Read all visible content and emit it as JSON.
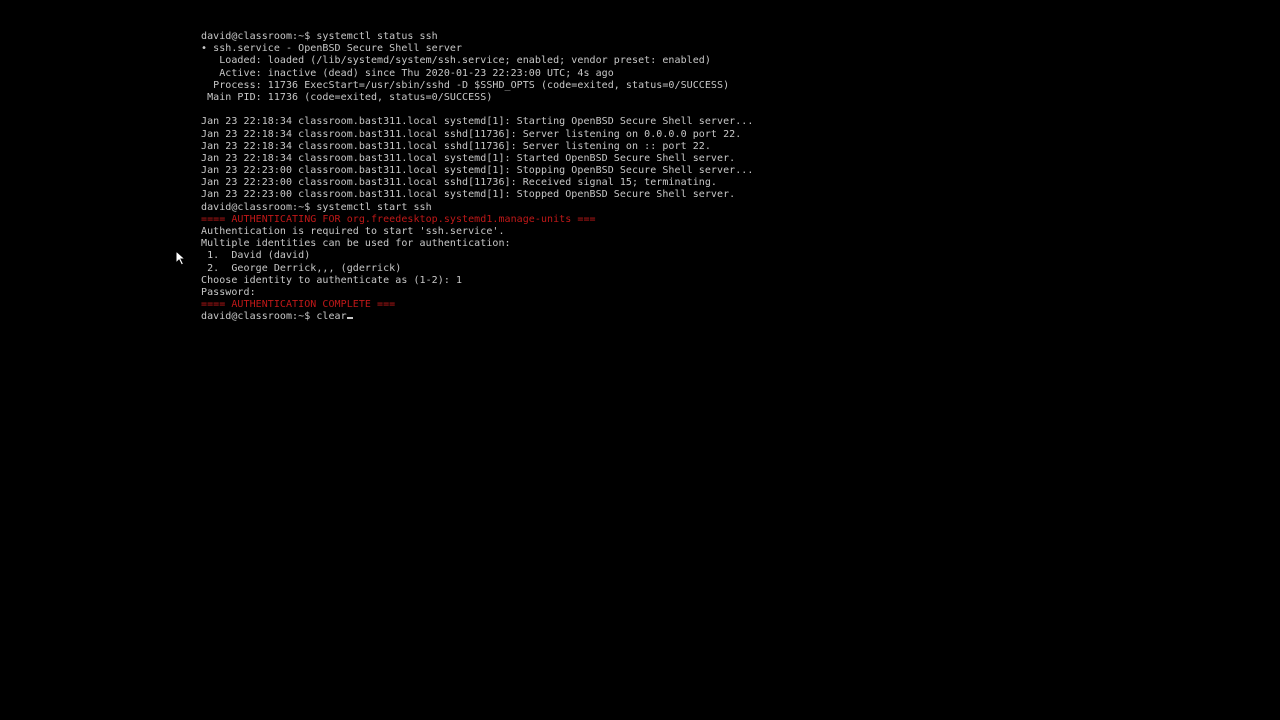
{
  "terminal": {
    "status_block": {
      "prompt": "david@classroom:~$ systemctl status ssh",
      "unit_line": "• ssh.service - OpenBSD Secure Shell server",
      "loaded_line": "   Loaded: loaded (/lib/systemd/system/ssh.service; enabled; vendor preset: enabled)",
      "active_line": "   Active: inactive (dead) since Thu 2020-01-23 22:23:00 UTC; 4s ago",
      "process_line": "  Process: 11736 ExecStart=/usr/sbin/sshd -D $SSHD_OPTS (code=exited, status=0/SUCCESS)",
      "mainpid_line": " Main PID: 11736 (code=exited, status=0/SUCCESS)"
    },
    "journal": [
      "Jan 23 22:18:34 classroom.bast311.local systemd[1]: Starting OpenBSD Secure Shell server...",
      "Jan 23 22:18:34 classroom.bast311.local sshd[11736]: Server listening on 0.0.0.0 port 22.",
      "Jan 23 22:18:34 classroom.bast311.local sshd[11736]: Server listening on :: port 22.",
      "Jan 23 22:18:34 classroom.bast311.local systemd[1]: Started OpenBSD Secure Shell server.",
      "Jan 23 22:23:00 classroom.bast311.local systemd[1]: Stopping OpenBSD Secure Shell server...",
      "Jan 23 22:23:00 classroom.bast311.local sshd[11736]: Received signal 15; terminating.",
      "Jan 23 22:23:00 classroom.bast311.local systemd[1]: Stopped OpenBSD Secure Shell server."
    ],
    "start_block": {
      "prompt": "david@classroom:~$ systemctl start ssh",
      "auth_banner": "==== AUTHENTICATING FOR org.freedesktop.systemd1.manage-units ===",
      "auth_required": "Authentication is required to start 'ssh.service'.",
      "multiple_identities": "Multiple identities can be used for authentication:",
      "identity_1": " 1.  David (david)",
      "identity_2": " 2.  George Derrick,,, (gderrick)",
      "choose_identity": "Choose identity to authenticate as (1-2): 1",
      "password": "Password:",
      "auth_complete": "==== AUTHENTICATION COMPLETE ==="
    },
    "current_prompt": "david@classroom:~$ ",
    "current_input": "clear",
    "colors": {
      "background": "#000000",
      "text": "#c8c8c8",
      "auth_banner": "#c01818"
    }
  },
  "pointer": {
    "icon": "mouse-pointer-icon"
  }
}
